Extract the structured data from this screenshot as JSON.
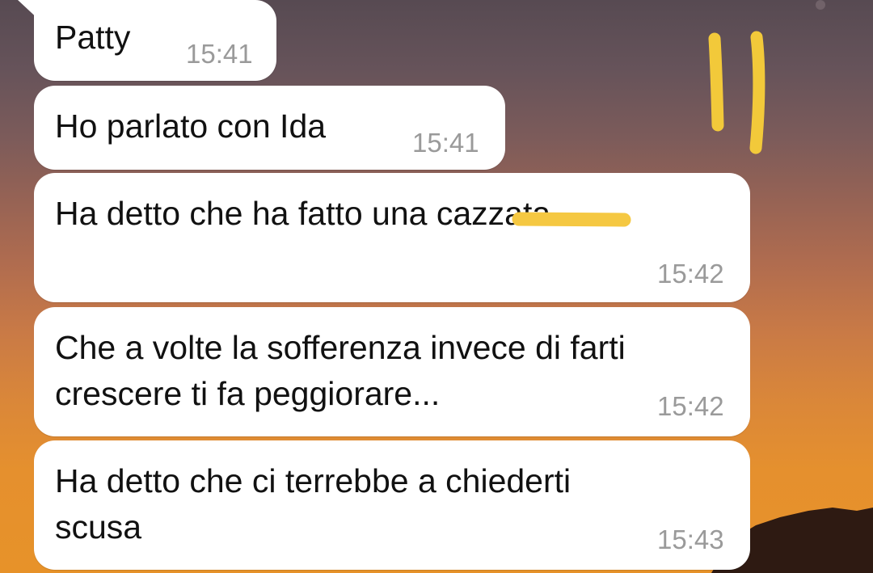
{
  "chat": {
    "messages": [
      {
        "text": "Patty",
        "time": "15:41"
      },
      {
        "text": "Ho parlato con Ida",
        "time": "15:41"
      },
      {
        "text": "Ha detto che ha fatto una cazzata",
        "time": "15:42"
      },
      {
        "text_line1": "Che a volte la sofferenza invece di farti",
        "text_line2": "crescere ti fa peggiorare...",
        "time": "15:42"
      },
      {
        "text_line1": "Ha detto che ci terrebbe a chiederti",
        "text_line2": "scusa",
        "time": "15:43"
      }
    ]
  },
  "colors": {
    "bubble": "#ffffff",
    "timestamp": "#9a9a9a",
    "redaction_highlight": "#f5c842"
  },
  "icons": {
    "redaction": "highlighter-redaction",
    "annotation": "handwritten-marks"
  }
}
